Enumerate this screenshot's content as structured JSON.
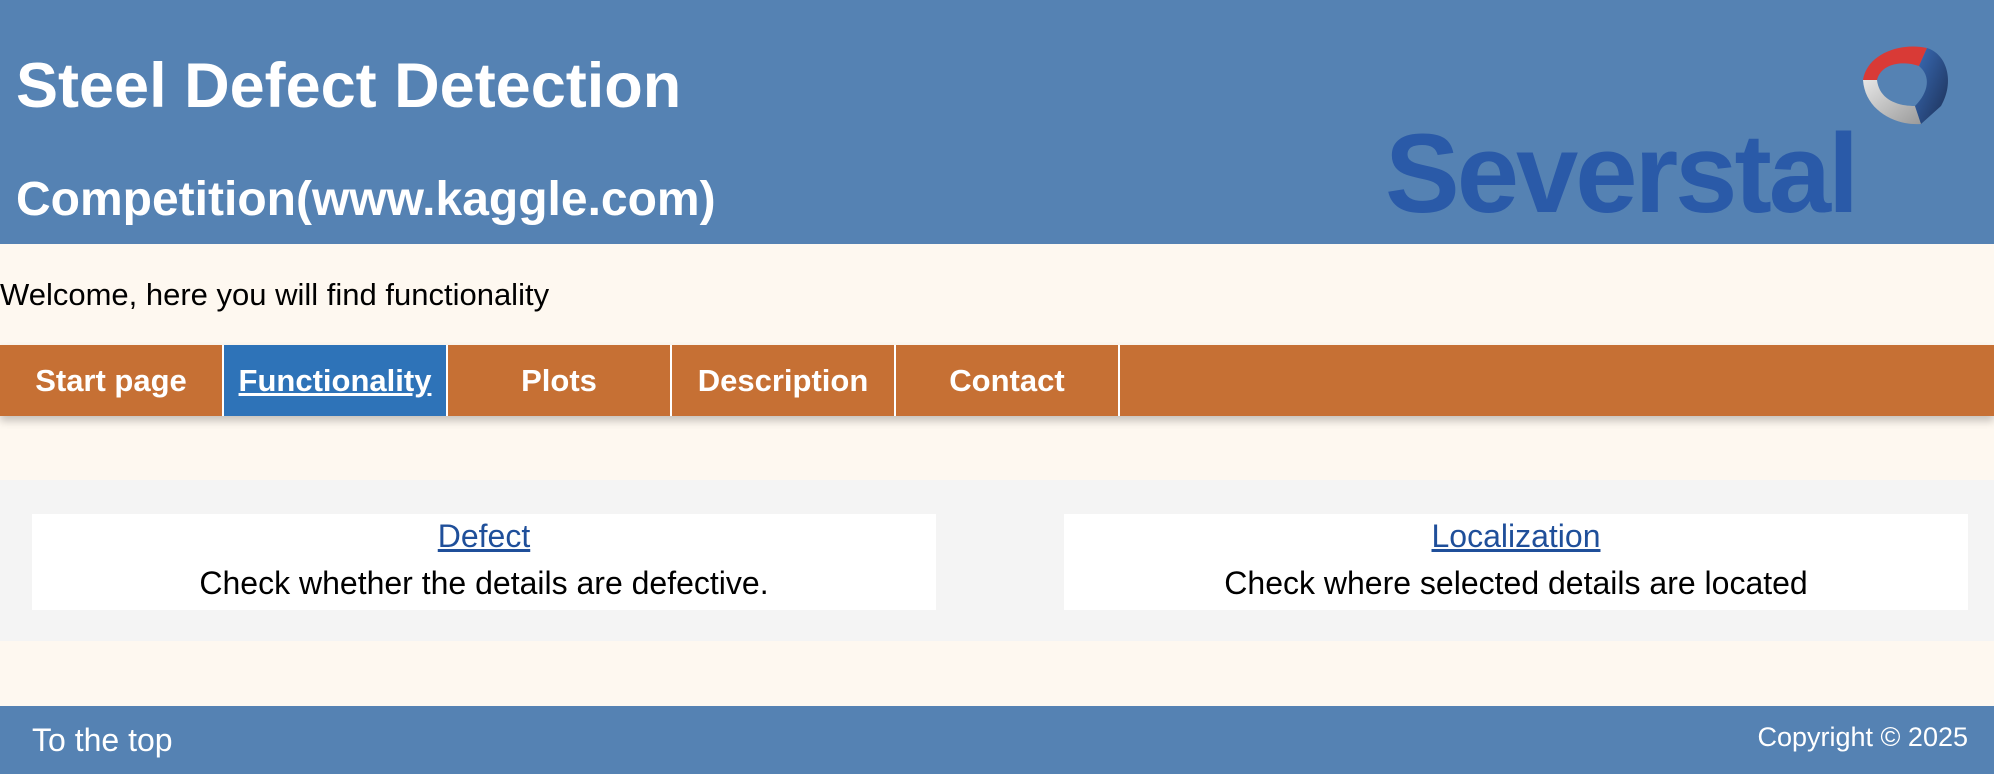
{
  "header": {
    "title": "Steel Defect Detection",
    "subtitle": "Competition(www.kaggle.com)",
    "logo_text": "Severstal"
  },
  "welcome_text": "Welcome, here you will find functionality",
  "nav": {
    "items": [
      {
        "label": "Start page"
      },
      {
        "label": "Functionality"
      },
      {
        "label": "Plots"
      },
      {
        "label": "Description"
      },
      {
        "label": "Contact"
      }
    ],
    "active": "Functionality"
  },
  "cards": [
    {
      "link": "Defect",
      "description": "Check whether the details are defective."
    },
    {
      "link": "Localization",
      "description": "Check where selected details are located"
    }
  ],
  "footer": {
    "to_top": "To the top",
    "copyright": "Copyright © 2025"
  },
  "colors": {
    "header_bg": "#5582b3",
    "nav_bg": "#c67034",
    "nav_active_bg": "#2e73b8",
    "page_bg": "#fef8f0",
    "link": "#1f4f9a"
  }
}
